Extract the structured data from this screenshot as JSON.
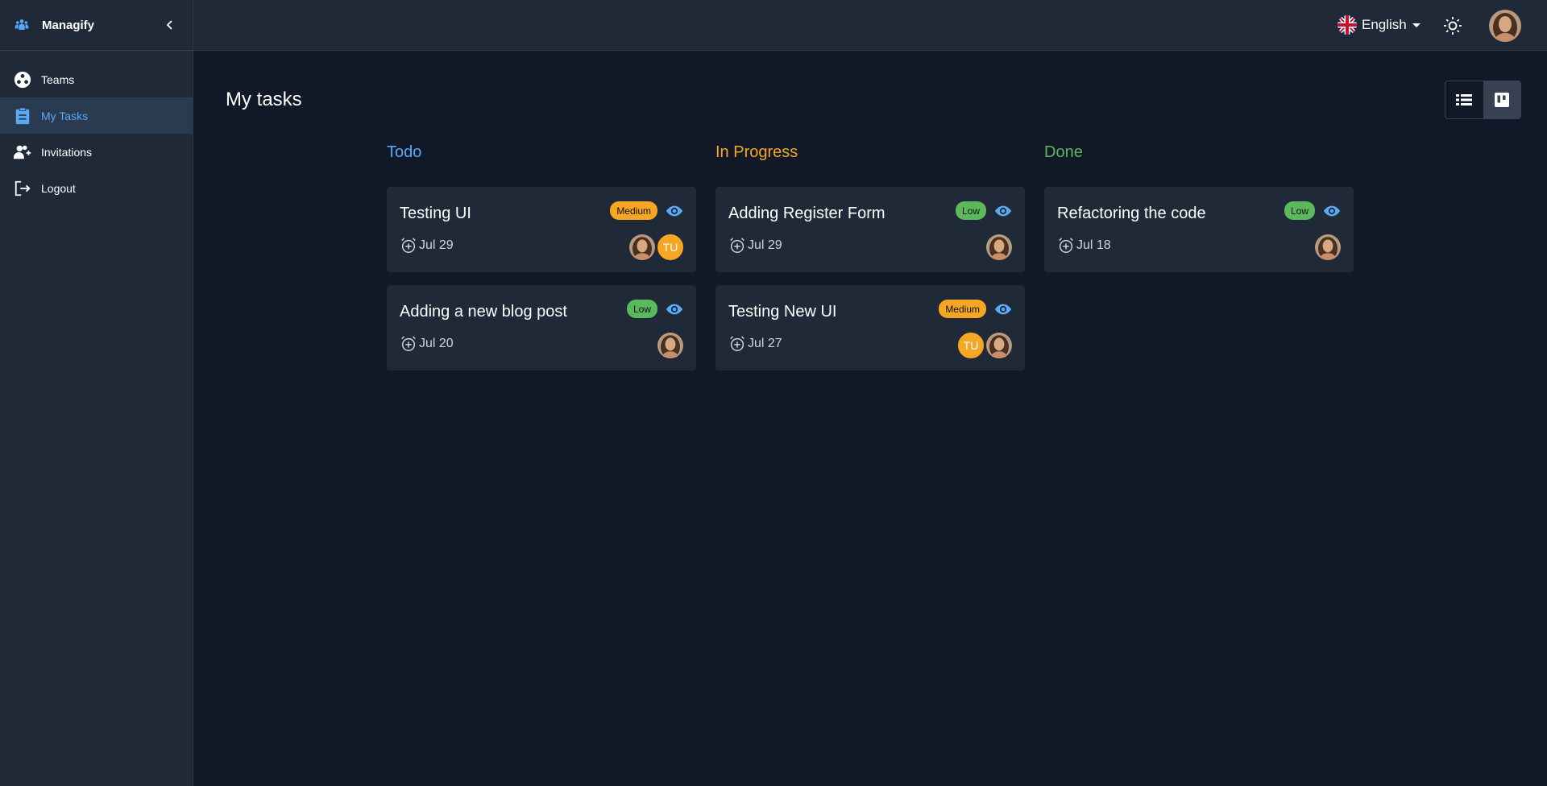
{
  "app": {
    "name": "Managify"
  },
  "sidebar": {
    "items": [
      {
        "label": "Teams",
        "icon": "teams-icon",
        "active": false
      },
      {
        "label": "My Tasks",
        "icon": "clipboard-icon",
        "active": true
      },
      {
        "label": "Invitations",
        "icon": "add-user-icon",
        "active": false
      },
      {
        "label": "Logout",
        "icon": "logout-icon",
        "active": false
      }
    ]
  },
  "topbar": {
    "language": "English"
  },
  "main": {
    "title": "My tasks",
    "columns": [
      {
        "title": "Todo",
        "color": "#5aa9f5",
        "cards": [
          {
            "title": "Testing UI",
            "priority": "Medium",
            "due": "Jul 29",
            "assignees": [
              "photo",
              "TU"
            ]
          },
          {
            "title": "Adding a new blog post",
            "priority": "Low",
            "due": "Jul 20",
            "assignees": [
              "photo"
            ]
          }
        ]
      },
      {
        "title": "In Progress",
        "color": "#f5a623",
        "cards": [
          {
            "title": "Adding Register Form",
            "priority": "Low",
            "due": "Jul 29",
            "assignees": [
              "photo"
            ]
          },
          {
            "title": "Testing New UI",
            "priority": "Medium",
            "due": "Jul 27",
            "assignees": [
              "TU",
              "photo"
            ]
          }
        ]
      },
      {
        "title": "Done",
        "color": "#5cb85c",
        "cards": [
          {
            "title": "Refactoring the code",
            "priority": "Low",
            "due": "Jul 18",
            "assignees": [
              "photo"
            ]
          }
        ]
      }
    ]
  }
}
